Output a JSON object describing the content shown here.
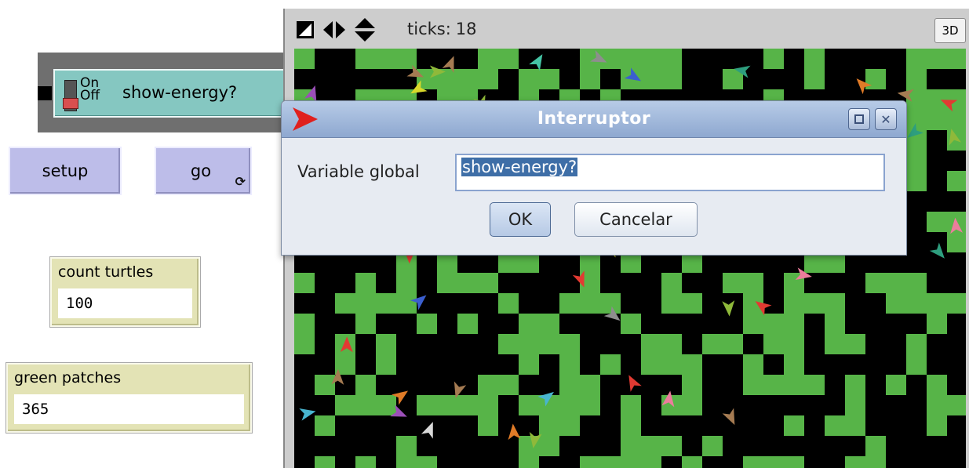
{
  "switch": {
    "label": "show-energy?",
    "on_label": "On",
    "off_label": "Off",
    "state": "off"
  },
  "buttons": {
    "setup_label": "setup",
    "go_label": "go",
    "go_forever_icon": "forever-icon"
  },
  "monitors": {
    "turtles": {
      "label": "count turtles",
      "value": "100"
    },
    "green": {
      "label": "green patches",
      "value": "365"
    }
  },
  "view": {
    "ticks_label": "ticks:",
    "ticks_value": "18",
    "btn_3d": "3D",
    "icons": [
      "speed-icon",
      "horizontal-wrap-icon",
      "vertical-wrap-icon"
    ],
    "patch_color": "#57b448",
    "background_color": "#000000"
  },
  "dialog": {
    "title": "Interruptor",
    "variable_label": "Variable global",
    "variable_value": "show-energy?",
    "ok_label": "OK",
    "cancel_label": "Cancelar"
  }
}
